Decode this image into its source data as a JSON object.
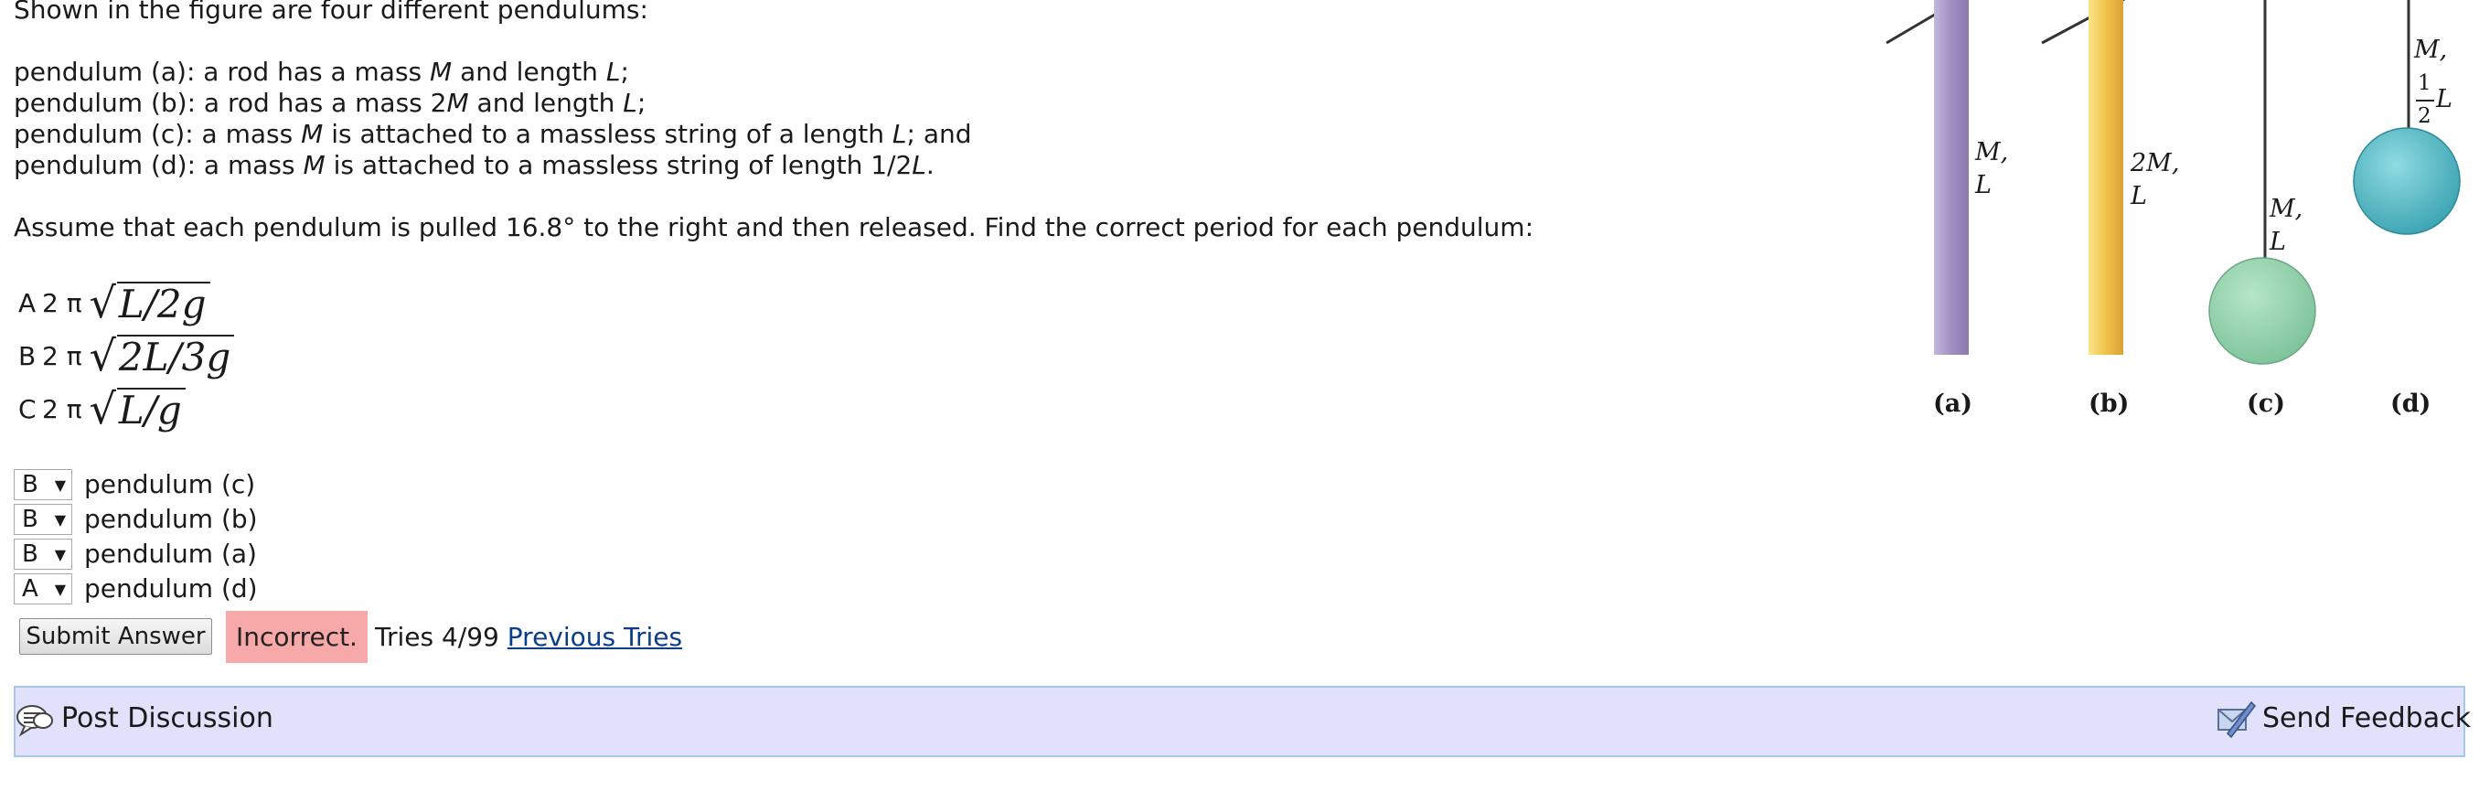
{
  "problem": {
    "intro": "Shown in the figure are four different pendulums:",
    "pendulums": [
      {
        "pre": "pendulum (a): a rod has a mass ",
        "m": "M",
        "mid": " and length ",
        "l": "L",
        "post": ";"
      },
      {
        "pre": "pendulum (b): a rod has a mass 2",
        "m": "M",
        "mid": " and length ",
        "l": "L",
        "post": ";"
      },
      {
        "pre": "pendulum (c): a mass ",
        "m": "M",
        "mid": " is attached to a massless string of a length ",
        "l": "L",
        "post": "; and"
      },
      {
        "pre": "pendulum (d): a mass ",
        "m": "M",
        "mid": " is attached to a massless string of length 1/2",
        "l": "L",
        "post": "."
      }
    ],
    "instruction": "Assume that each pendulum is pulled 16.8° to the right and then released. Find the correct period for each pendulum:"
  },
  "options": [
    {
      "letter": "A",
      "prefix": "2 π",
      "formula": "L/2g"
    },
    {
      "letter": "B",
      "prefix": "2 π",
      "formula": "2L/3g"
    },
    {
      "letter": "C",
      "prefix": "2 π",
      "formula": "L/g"
    }
  ],
  "matches": [
    {
      "selected": "B",
      "label": "pendulum (c)"
    },
    {
      "selected": "B",
      "label": "pendulum (b)"
    },
    {
      "selected": "B",
      "label": "pendulum (a)"
    },
    {
      "selected": "A",
      "label": "pendulum (d)"
    }
  ],
  "submit": {
    "button_label": "Submit Answer",
    "status": "Incorrect.",
    "tries": "Tries 4/99",
    "previous_tries": "Previous Tries"
  },
  "footer": {
    "post_discussion": "Post Discussion",
    "send_feedback": "Send Feedback"
  },
  "figure": {
    "labels": [
      "(a)",
      "(b)",
      "(c)",
      "(d)"
    ],
    "a": {
      "m": "M,",
      "l": "L"
    },
    "b": {
      "m": "2M,",
      "l": "L"
    },
    "c": {
      "m": "M,",
      "l": "L"
    },
    "d": {
      "m": "M,",
      "num": "1",
      "den": "2",
      "l": "L"
    },
    "colors": {
      "rod_a": "#a18fc2",
      "rod_b": "#f0c24a",
      "bob_c": "#8fd0a8",
      "bob_d": "#4fb8c4"
    }
  },
  "colors": {
    "incorrect_bg": "#f7a8a8",
    "footer_bg": "#e1e1fb",
    "link": "#0b3d8c"
  }
}
